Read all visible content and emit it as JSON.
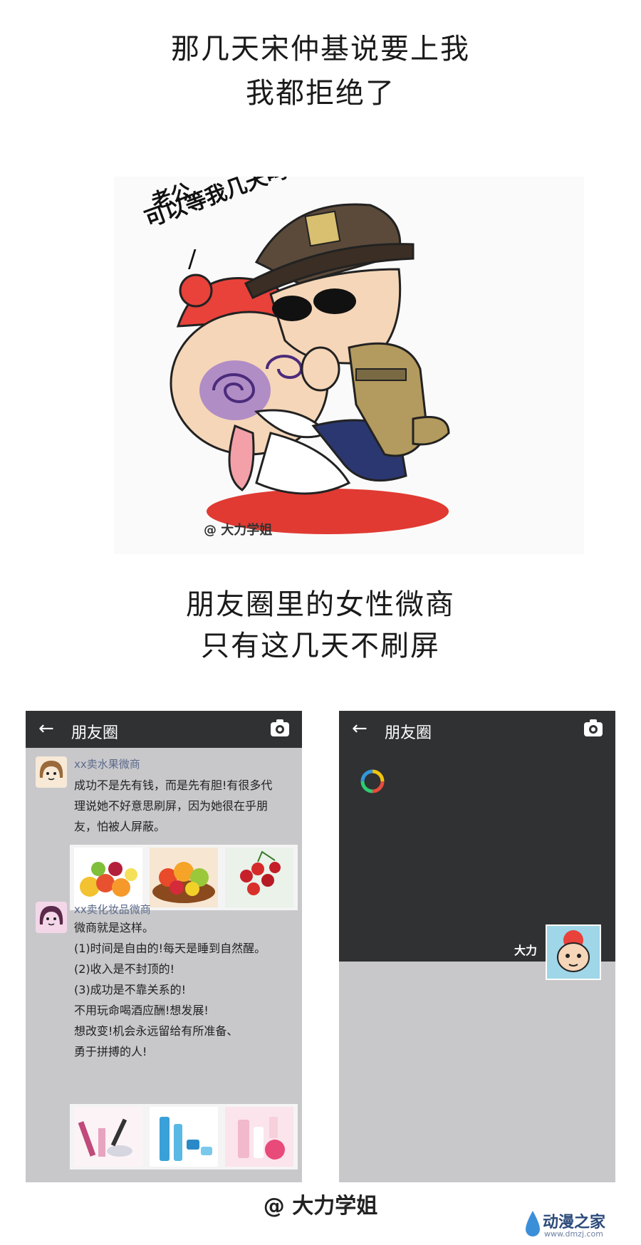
{
  "top_caption": {
    "line1": "那几天宋仲基说要上我",
    "line2": "我都拒绝了"
  },
  "illustration": {
    "speech_line1": "老公",
    "speech_line2": "可以等我几天吗~",
    "speech_tail": "/",
    "signature": "@ 大力学姐"
  },
  "middle_caption": {
    "line1": "朋友圈里的女性微商",
    "line2": "只有这几天不刷屏"
  },
  "left_phone": {
    "back_icon": "←",
    "title": "朋友圈",
    "posts": [
      {
        "user": "xx卖水果微商",
        "text": "成功不是先有钱，而是先有胆!有很多代\n理说她不好意思刷屏，因为她很在乎朋\n友，怕被人屏蔽。",
        "pics": [
          "fruit-basket",
          "fruit-bowl",
          "cherries"
        ]
      },
      {
        "user": "xx卖化妆品微商",
        "text": "微商就是这样。\n(1)时间是自由的!每天是睡到自然醒。\n(2)收入是不封顶的!\n(3)成功是不靠关系的!\n   不用玩命喝酒应酬!想发展!\n   想改变!机会永远留给有所准备、\n   勇于拼搏的人!",
        "pics": [
          "cosmetics-set",
          "skincare-bottles",
          "pink-cosmetics"
        ]
      }
    ]
  },
  "right_phone": {
    "back_icon": "←",
    "title": "朋友圈",
    "username": "大力"
  },
  "footer_signature": "@ 大力学姐",
  "watermark": {
    "brand": "动漫之家",
    "url": "www.dmzj.com"
  },
  "colors": {
    "topbar": "#2f3133",
    "feed_bg": "#c8c8cb",
    "username": "#5c6a8a",
    "hat_red": "#e8423a",
    "uniform_khaki": "#b39a5e"
  }
}
